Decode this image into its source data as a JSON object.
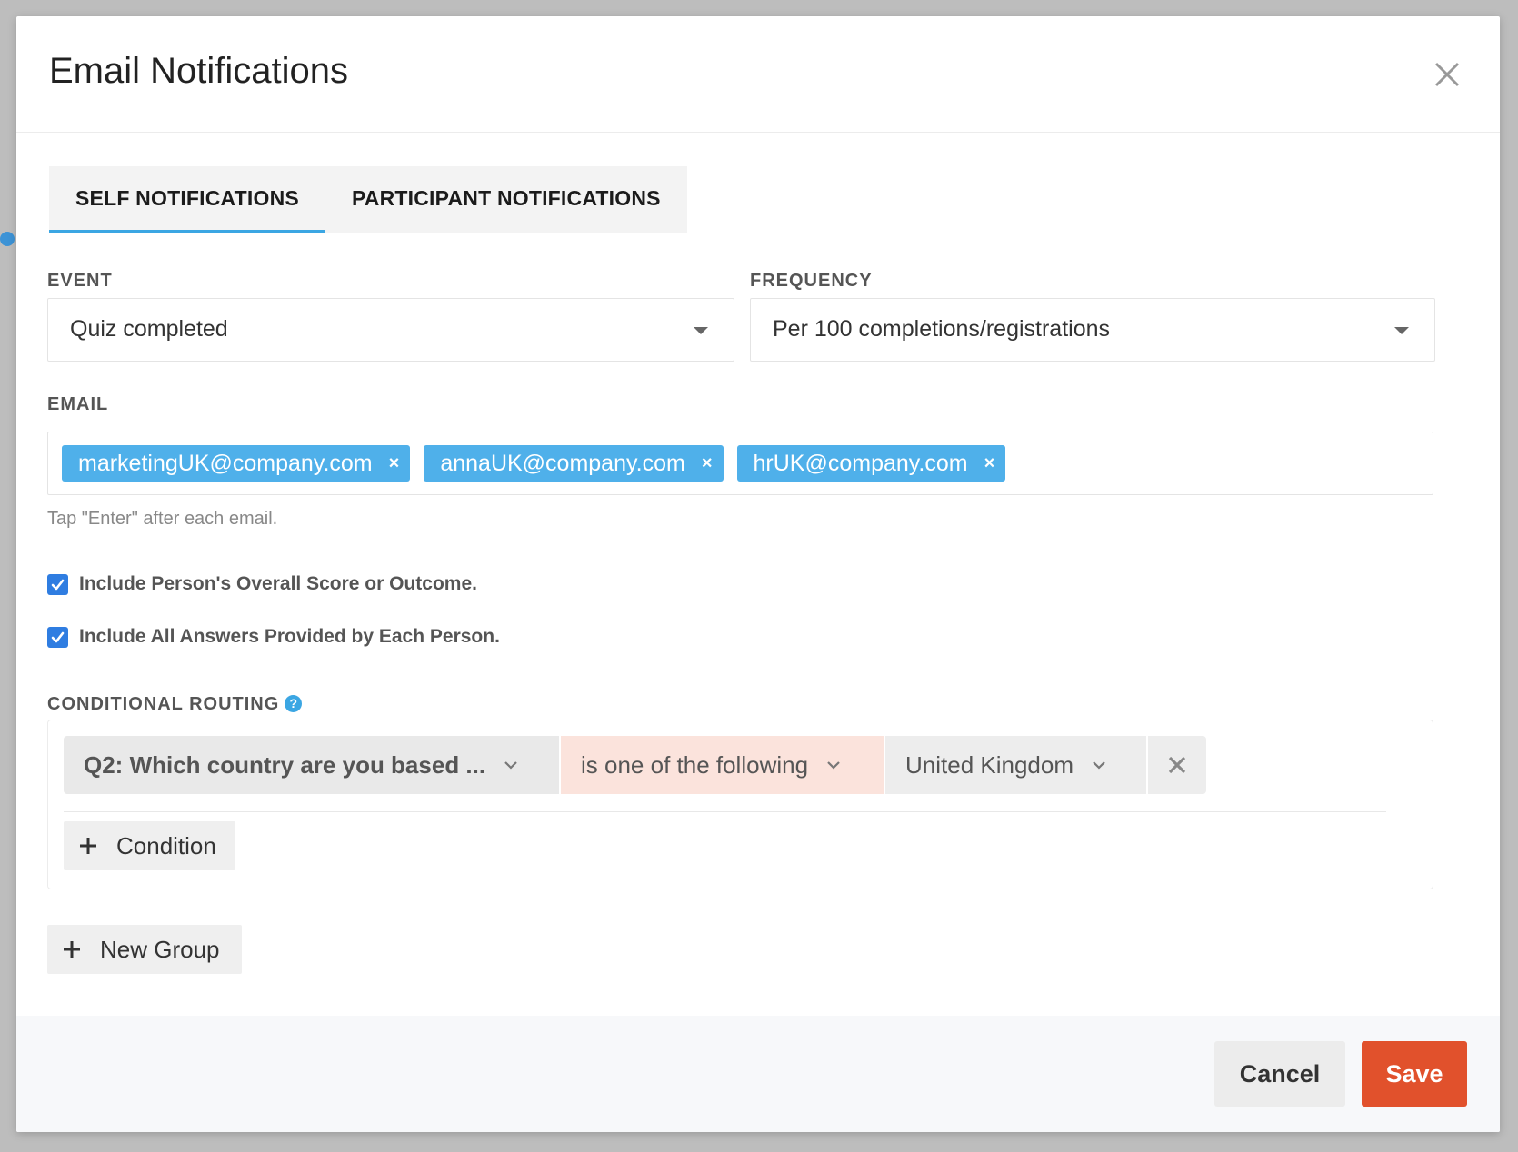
{
  "modal": {
    "title": "Email Notifications"
  },
  "tabs": [
    {
      "label": "SELF NOTIFICATIONS",
      "active": true
    },
    {
      "label": "PARTICIPANT NOTIFICATIONS",
      "active": false
    }
  ],
  "event": {
    "label": "EVENT",
    "value": "Quiz completed"
  },
  "frequency": {
    "label": "FREQUENCY",
    "value": "Per 100 completions/registrations"
  },
  "email": {
    "label": "EMAIL",
    "chips": [
      "marketingUK@company.com",
      "annaUK@company.com",
      "hrUK@company.com"
    ],
    "remove_glyph": "×",
    "hint": "Tap \"Enter\" after each email."
  },
  "options": {
    "include_score": {
      "label": "Include Person's Overall Score or Outcome.",
      "checked": true
    },
    "include_answers": {
      "label": "Include All Answers Provided by Each Person.",
      "checked": true
    }
  },
  "routing": {
    "label": "CONDITIONAL ROUTING",
    "help_glyph": "?",
    "condition": {
      "question": "Q2: Which country are you based ...",
      "operator": "is one of the following",
      "value": "United Kingdom"
    },
    "add_condition_label": "Condition",
    "new_group_label": "New Group"
  },
  "footer": {
    "cancel_label": "Cancel",
    "save_label": "Save"
  },
  "colors": {
    "accent": "#3ba6e3",
    "chip": "#4fb0ea",
    "checkbox": "#2f7de1",
    "save": "#e1512c",
    "operator_bg": "#fbe3dc"
  }
}
